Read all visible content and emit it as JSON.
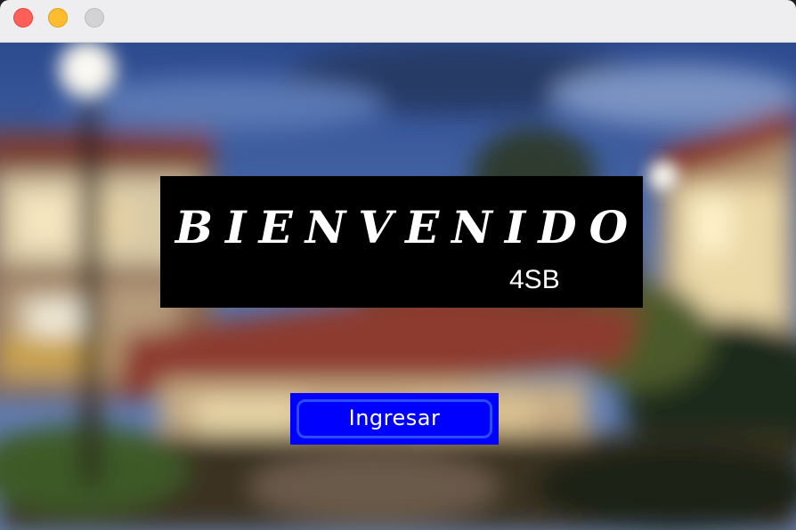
{
  "window": {
    "controls": [
      "close",
      "minimize",
      "zoom"
    ]
  },
  "background": {
    "description_icon": "blurred-campus-photo"
  },
  "welcome": {
    "title": "BIENVENIDO",
    "subtitle": "4SB"
  },
  "actions": {
    "enter_label": "Ingresar"
  },
  "colors": {
    "panel": "#000000",
    "button": "#0000ff",
    "text": "#ffffff"
  }
}
